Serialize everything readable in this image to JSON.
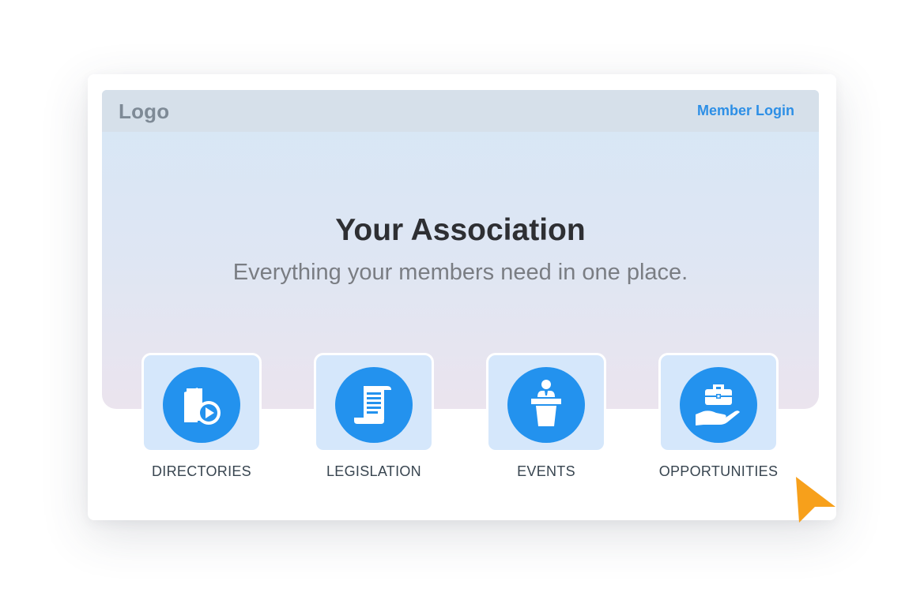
{
  "header": {
    "logo_text": "Logo",
    "login_label": "Member Login"
  },
  "hero": {
    "title": "Your Association",
    "subtitle": "Everything your members need in one place."
  },
  "tiles": [
    {
      "label": "DIRECTORIES",
      "icon": "directory-play-icon"
    },
    {
      "label": "LEGISLATION",
      "icon": "scroll-document-icon"
    },
    {
      "label": "EVENTS",
      "icon": "speaker-podium-icon"
    },
    {
      "label": "OPPORTUNITIES",
      "icon": "briefcase-hand-icon"
    }
  ],
  "colors": {
    "accent_blue": "#2392ee",
    "link_blue": "#2d8fe6",
    "tile_background": "#d5e7fb",
    "cursor_orange": "#f7a01b"
  }
}
